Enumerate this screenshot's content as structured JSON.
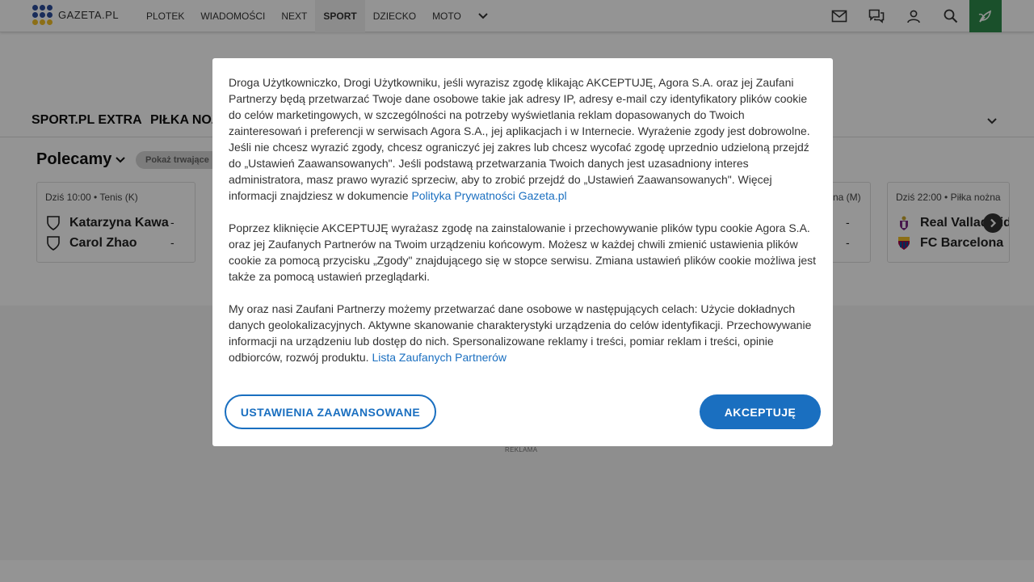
{
  "colors": {
    "accent": "#1a6fc0",
    "leaf_button": "#2e8b4a",
    "logo_dots": [
      "#2b4c9b",
      "#2b4c9b",
      "#2b4c9b",
      "#2b4c9b",
      "#2b4c9b",
      "#2b4c9b",
      "#f2c029",
      "#f2c029",
      "#f2c029"
    ]
  },
  "topnav": {
    "logo_text": "GAZETA.PL",
    "items": [
      "PLOTEK",
      "WIADOMOŚCI",
      "NEXT",
      "SPORT",
      "DZIECKO",
      "MOTO"
    ],
    "active_item": "SPORT",
    "icons": [
      "mail-icon",
      "chat-icon",
      "user-icon",
      "search-icon",
      "leaf-icon"
    ]
  },
  "subnav": {
    "items": [
      "SPORT.PL EXTRA",
      "PIŁKA NOŻ"
    ]
  },
  "recommended": {
    "title": "Polecamy",
    "pill_label": "Pokaż trwające"
  },
  "cards": [
    {
      "header": "Dziś 10:00 • Tenis (K)",
      "teams": [
        {
          "name": "Katarzyna Kawa",
          "score": "-"
        },
        {
          "name": "Carol Zhao",
          "score": "-"
        }
      ]
    },
    {
      "header": "na (M)",
      "teams": [
        {
          "name": "",
          "score": "-"
        },
        {
          "name": "",
          "score": "-"
        }
      ]
    },
    {
      "header": "Dziś 22:00 • Piłka nożna",
      "teams": [
        {
          "name": "Real Valladolid",
          "score": ""
        },
        {
          "name": "FC Barcelona",
          "score": ""
        }
      ]
    }
  ],
  "ad_label": "REKLAMA",
  "consent": {
    "paragraph1": "Droga Użytkowniczko, Drogi Użytkowniku, jeśli wyrazisz zgodę klikając AKCEPTUJĘ, Agora S.A. oraz jej Zaufani Partnerzy będą przetwarzać Twoje dane osobowe takie jak adresy IP, adresy e-mail czy identyfikatory plików cookie do celów marketingowych, w szczególności na potrzeby wyświetlania reklam dopasowanych do Twoich zainteresowań i preferencji w serwisach Agora S.A., jej aplikacjach i w Internecie. Wyrażenie zgody jest dobrowolne. Jeśli nie chcesz wyrazić zgody, chcesz ograniczyć jej zakres lub chcesz wycofać zgodę uprzednio udzieloną przejdź do „Ustawień Zaawansowanych\". Jeśli podstawą przetwarzania Twoich danych jest uzasadniony interes administratora, masz prawo wyrazić sprzeciw, aby to zrobić przejdź do „Ustawień Zaawansowanych\". Więcej informacji znajdziesz w dokumencie",
    "privacy_link": "Polityka Prywatności Gazeta.pl",
    "paragraph2": "Poprzez kliknięcie AKCEPTUJĘ wyrażasz zgodę na zainstalowanie i przechowywanie plików typu cookie Agora S.A. oraz jej Zaufanych Partnerów na Twoim urządzeniu końcowym. Możesz w każdej chwili zmienić ustawienia plików cookie za pomocą przycisku „Zgody\" znajdującego się w stopce serwisu. Zmiana ustawień plików cookie możliwa jest także za pomocą ustawień przeglądarki.",
    "paragraph3": "My oraz nasi Zaufani Partnerzy możemy przetwarzać dane osobowe w następujących celach: Użycie dokładnych danych geolokalizacyjnych. Aktywne skanowanie charakterystyki urządzenia do celów identyfikacji. Przechowywanie informacji na urządzeniu lub dostęp do nich. Spersonalizowane reklamy i treści, pomiar reklam i treści, opinie odbiorców, rozwój produktu.",
    "partners_link": "Lista Zaufanych Partnerów",
    "advanced_button": "USTAWIENIA ZAAWANSOWANE",
    "accept_button": "AKCEPTUJĘ"
  }
}
